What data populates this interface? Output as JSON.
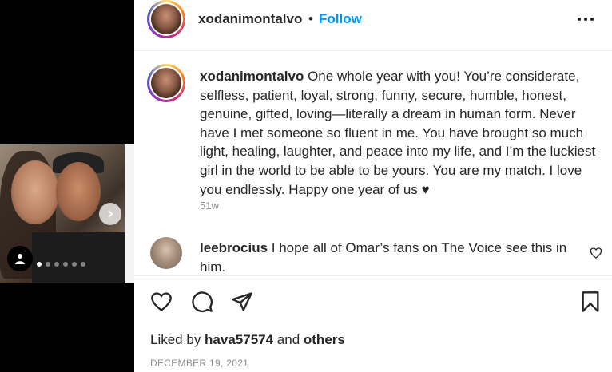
{
  "post": {
    "username": "xodanimontalvo",
    "separator": "•",
    "follow_label": "Follow",
    "caption_user": "xodanimontalvo",
    "caption_text": " One whole year with you! You’re considerate, selfless, patient, loyal, strong, funny, secure, humble, honest, genuine, gifted, loving—literally a dream in human form. Never have I met someone so fluent in me. You have brought so much light, healing, laughter, and peace into my life, and I’m the luckiest girl in the world to be able to be yours. You are my match. I love you endlessly. Happy one year of us ♥",
    "time_ago": "51w",
    "date": "DECEMBER 19, 2021",
    "carousel": {
      "total_images": 6,
      "active_index": 0
    }
  },
  "comment": {
    "username": "leebrocius",
    "text": " I hope all of Omar’s fans on The Voice see this in him."
  },
  "likes": {
    "prefix": "Liked by ",
    "user": "hava57574",
    "middle": " and ",
    "others": "others"
  },
  "icons": {
    "more": "more-options-icon",
    "like": "heart-icon",
    "comment": "comment-icon",
    "share": "share-icon",
    "save": "bookmark-icon",
    "comment_like": "heart-small-icon",
    "tagged": "user-tag-icon",
    "next": "chevron-right-icon"
  },
  "colors": {
    "follow": "#0095f6",
    "text": "#262626",
    "muted": "#8e8e8e"
  }
}
